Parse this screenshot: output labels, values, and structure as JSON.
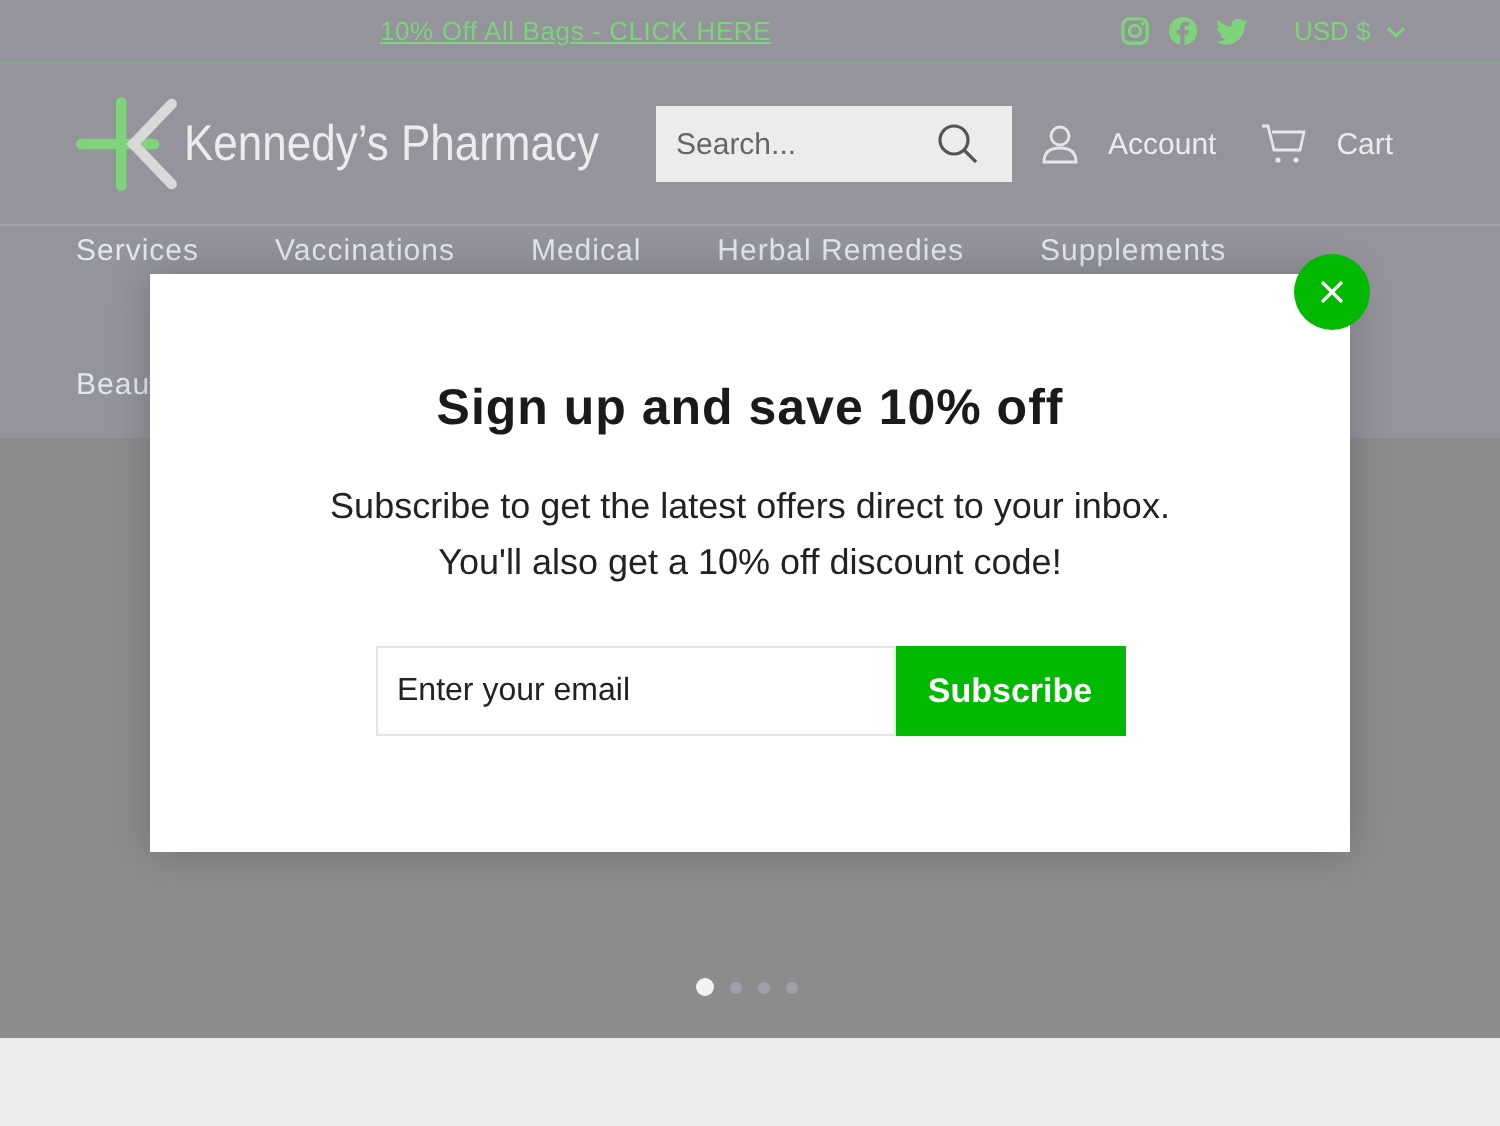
{
  "announcement": {
    "link": "10% Off All Bags - CLICK HERE"
  },
  "currency": {
    "label": "USD $"
  },
  "logo": {
    "text": "Kennedy’s Pharmacy"
  },
  "search": {
    "placeholder": "Search..."
  },
  "header_links": [
    {
      "kind": "account",
      "label": "Account"
    },
    {
      "kind": "cart",
      "label": "Cart"
    }
  ],
  "nav": [
    {
      "label": "Services"
    },
    {
      "label": "Vaccinations"
    },
    {
      "label": "Medical"
    },
    {
      "label": "Herbal Remedies"
    },
    {
      "label": "Supplements"
    }
  ],
  "nav_row_2": [
    {
      "label": "Beau"
    }
  ],
  "slides": [
    {
      "selected": true
    },
    {
      "selected": false
    },
    {
      "selected": false
    },
    {
      "selected": false
    }
  ],
  "popup": {
    "title": "Sign up and save 10% off",
    "text_lines": [
      "Subscribe to get the latest offers direct to your inbox.",
      "You'll also get a 10% off discount code!"
    ],
    "email_placeholder": "Enter your email",
    "button": "Subscribe"
  }
}
